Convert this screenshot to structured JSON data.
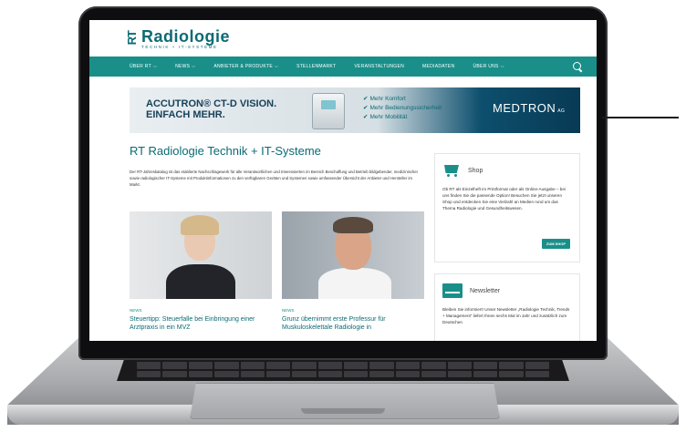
{
  "site": {
    "logo_mark": "RT",
    "logo_name": "Radiologie",
    "logo_tagline": "TECHNIK + IT-SYSTEME"
  },
  "nav": {
    "items": [
      {
        "label": "ÜBER RT",
        "has_dropdown": true
      },
      {
        "label": "NEWS",
        "has_dropdown": true
      },
      {
        "label": "ANBIETER & PRODUKTE",
        "has_dropdown": true
      },
      {
        "label": "STELLENMARKT",
        "has_dropdown": false
      },
      {
        "label": "VERANSTALTUNGEN",
        "has_dropdown": false
      },
      {
        "label": "MEDIADATEN",
        "has_dropdown": false
      },
      {
        "label": "ÜBER UNS",
        "has_dropdown": true
      }
    ],
    "search_icon": "search-icon",
    "color": "#1a8f8a"
  },
  "banner": {
    "headline_1": "ACCUTRON® CT-D VISION.",
    "headline_2": "EINFACH MEHR.",
    "features": [
      "Mehr Komfort",
      "Mehr Bedienungssicherheit",
      "Mehr Mobilität"
    ],
    "brand": "MEDTRON",
    "brand_suffix": "AG"
  },
  "main": {
    "title": "RT Radiologie Technik + IT-Systeme",
    "intro": "Der RT-Jahreskatalog ist das etablierte Nachschlagewerk für alle Verantwortlichen und Interessierten im Bereich Beschaffung und Betrieb bildgebender, medizinischer sowie radiologischer IT-Systeme mit Produktinformationen zu den verfügbaren Geräten und Systemen sowie umfassender Übersicht der Anbieter und Hersteller im Markt.",
    "articles": [
      {
        "category": "NEWS",
        "title": "Steuertipp: Steuerfalle bei Einbringung einer Arztpraxis in ein MVZ"
      },
      {
        "category": "NEWS",
        "title": "Grunz übernimmt erste Professur für Muskuloskelettale Radiologie in"
      }
    ]
  },
  "sidebar": {
    "shop": {
      "title": "Shop",
      "text": "Ob RT als Einzelheft im Printformat oder als Online-Ausgabe – bei uns finden Sie die passende Option! Besuchen Sie jetzt unseren Shop und entdecken Sie eine Vielzahl an Medien rund um das Thema Radiologie und Gesundheitswesen.",
      "button": "ZUM SHOP"
    },
    "newsletter": {
      "title": "Newsletter",
      "text": "Bleiben Sie informiert! Unser Newsletter „Radiologie Technik, Trends + Management“ liefert Ihnen sechs Mal im Jahr und zusätzlich zum Deutschen"
    }
  }
}
